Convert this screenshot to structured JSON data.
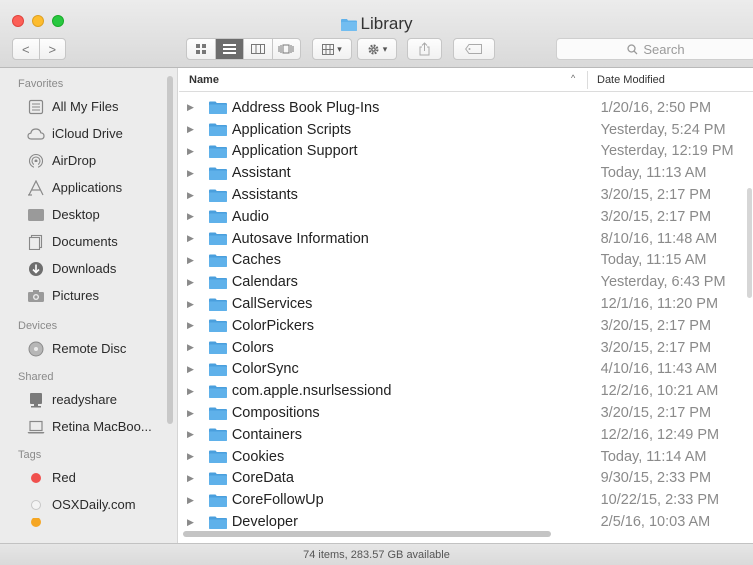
{
  "window": {
    "title": "Library"
  },
  "toolbar": {
    "back_symbol": "<",
    "forward_symbol": ">",
    "arrange_symbol": "▾",
    "action_symbol": "▾",
    "search_placeholder": "Search"
  },
  "sidebar": {
    "sections": [
      {
        "header": "Favorites",
        "items": [
          {
            "label": "All My Files",
            "icon": "all-files-icon"
          },
          {
            "label": "iCloud Drive",
            "icon": "cloud-icon"
          },
          {
            "label": "AirDrop",
            "icon": "airdrop-icon"
          },
          {
            "label": "Applications",
            "icon": "applications-icon"
          },
          {
            "label": "Desktop",
            "icon": "desktop-icon"
          },
          {
            "label": "Documents",
            "icon": "documents-icon"
          },
          {
            "label": "Downloads",
            "icon": "downloads-icon"
          },
          {
            "label": "Pictures",
            "icon": "pictures-icon"
          }
        ]
      },
      {
        "header": "Devices",
        "items": [
          {
            "label": "Remote Disc",
            "icon": "disc-icon"
          }
        ]
      },
      {
        "header": "Shared",
        "items": [
          {
            "label": "readyshare",
            "icon": "server-icon"
          },
          {
            "label": "Retina MacBoo...",
            "icon": "laptop-icon"
          }
        ]
      },
      {
        "header": "Tags",
        "items": [
          {
            "label": "Red",
            "icon": "tag-dot-icon",
            "color": "#f0504d"
          },
          {
            "label": "OSXDaily.com",
            "icon": "tag-dot-icon",
            "color": "#e6e6e6"
          }
        ]
      }
    ]
  },
  "list": {
    "columns": {
      "name": "Name",
      "date": "Date Modified"
    },
    "rows": [
      {
        "name": "Address Book Plug-Ins",
        "date": "1/20/16, 2:50 PM"
      },
      {
        "name": "Application Scripts",
        "date": "Yesterday, 5:24 PM"
      },
      {
        "name": "Application Support",
        "date": "Yesterday, 12:19 PM"
      },
      {
        "name": "Assistant",
        "date": "Today, 11:13 AM"
      },
      {
        "name": "Assistants",
        "date": "3/20/15, 2:17 PM"
      },
      {
        "name": "Audio",
        "date": "3/20/15, 2:17 PM"
      },
      {
        "name": "Autosave Information",
        "date": "8/10/16, 11:48 AM"
      },
      {
        "name": "Caches",
        "date": "Today, 11:15 AM"
      },
      {
        "name": "Calendars",
        "date": "Yesterday, 6:43 PM"
      },
      {
        "name": "CallServices",
        "date": "12/1/16, 11:20 PM"
      },
      {
        "name": "ColorPickers",
        "date": "3/20/15, 2:17 PM"
      },
      {
        "name": "Colors",
        "date": "3/20/15, 2:17 PM"
      },
      {
        "name": "ColorSync",
        "date": "4/10/16, 11:43 AM"
      },
      {
        "name": "com.apple.nsurlsessiond",
        "date": "12/2/16, 10:21 AM"
      },
      {
        "name": "Compositions",
        "date": "3/20/15, 2:17 PM"
      },
      {
        "name": "Containers",
        "date": "12/2/16, 12:49 PM"
      },
      {
        "name": "Cookies",
        "date": "Today, 11:14 AM"
      },
      {
        "name": "CoreData",
        "date": "9/30/15, 2:33 PM"
      },
      {
        "name": "CoreFollowUp",
        "date": "10/22/15, 2:33 PM"
      },
      {
        "name": "Developer",
        "date": "2/5/16, 10:03 AM"
      }
    ]
  },
  "statusbar": {
    "text": "74 items, 283.57 GB available"
  },
  "colors": {
    "folder": "#5fb1ea",
    "folder_tab": "#4a9fdd",
    "selection_gray": "#6c6c6c"
  }
}
